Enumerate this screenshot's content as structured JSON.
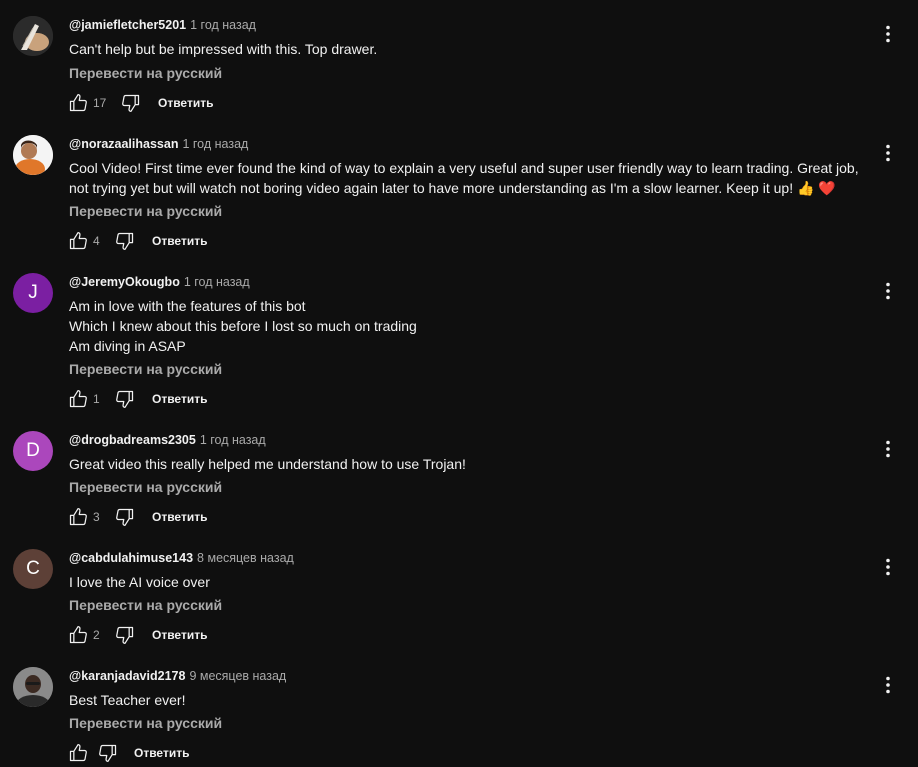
{
  "comments": [
    {
      "author": "@jamiefletcher5201",
      "time": "1 год назад",
      "lines": [
        "Can't help but be impressed with this. Top drawer."
      ],
      "translate_label": "Перевести на русский",
      "likes": "17",
      "reply_label": "Ответить",
      "avatar_icon": "photo-avatar"
    },
    {
      "author": "@norazaalihassan",
      "time": "1 год назад",
      "lines": [
        "Cool Video! First time ever found the kind of way to explain a very useful and super user friendly way to learn trading. Great job,",
        "not trying yet but will watch not boring video again later to have more understanding as I'm a slow learner. Keep it up!"
      ],
      "emoji": [
        "👍",
        "❤️"
      ],
      "translate_label": "Перевести на русский",
      "likes": "4",
      "reply_label": "Ответить",
      "avatar_icon": "photo-avatar"
    },
    {
      "author": "@JeremyOkougbo",
      "time": "1 год назад",
      "lines": [
        "Am in love with the features of this bot",
        "Which I knew about this before I lost so much on trading",
        "Am diving in ASAP"
      ],
      "translate_label": "Перевести на русский",
      "likes": "1",
      "reply_label": "Ответить",
      "avatar_letter": "J",
      "avatar_color": "#7b1fa2"
    },
    {
      "author": "@drogbadreams2305",
      "time": "1 год назад",
      "lines": [
        "Great video this really helped me understand how to use Trojan!"
      ],
      "translate_label": "Перевести на русский",
      "likes": "3",
      "reply_label": "Ответить",
      "avatar_letter": "D",
      "avatar_color": "#ab47bc"
    },
    {
      "author": "@cabdulahimuse143",
      "time": "8 месяцев назад",
      "lines": [
        "I love the AI voice over"
      ],
      "translate_label": "Перевести на русский",
      "likes": "2",
      "reply_label": "Ответить",
      "avatar_letter": "C",
      "avatar_color": "#5d4037"
    },
    {
      "author": "@karanjadavid2178",
      "time": "9 месяцев назад",
      "lines": [
        "Best Teacher ever!"
      ],
      "translate_label": "Перевести на русский",
      "likes": "",
      "reply_label": "Ответить",
      "avatar_icon": "photo-avatar"
    }
  ],
  "icons": {
    "like": "thumbs-up-icon",
    "dislike": "thumbs-down-icon",
    "menu": "more-vertical-icon"
  },
  "colors": {
    "background": "#0f0f0f",
    "primary_text": "#f1f1f1",
    "secondary_text": "#aaaaaa"
  }
}
